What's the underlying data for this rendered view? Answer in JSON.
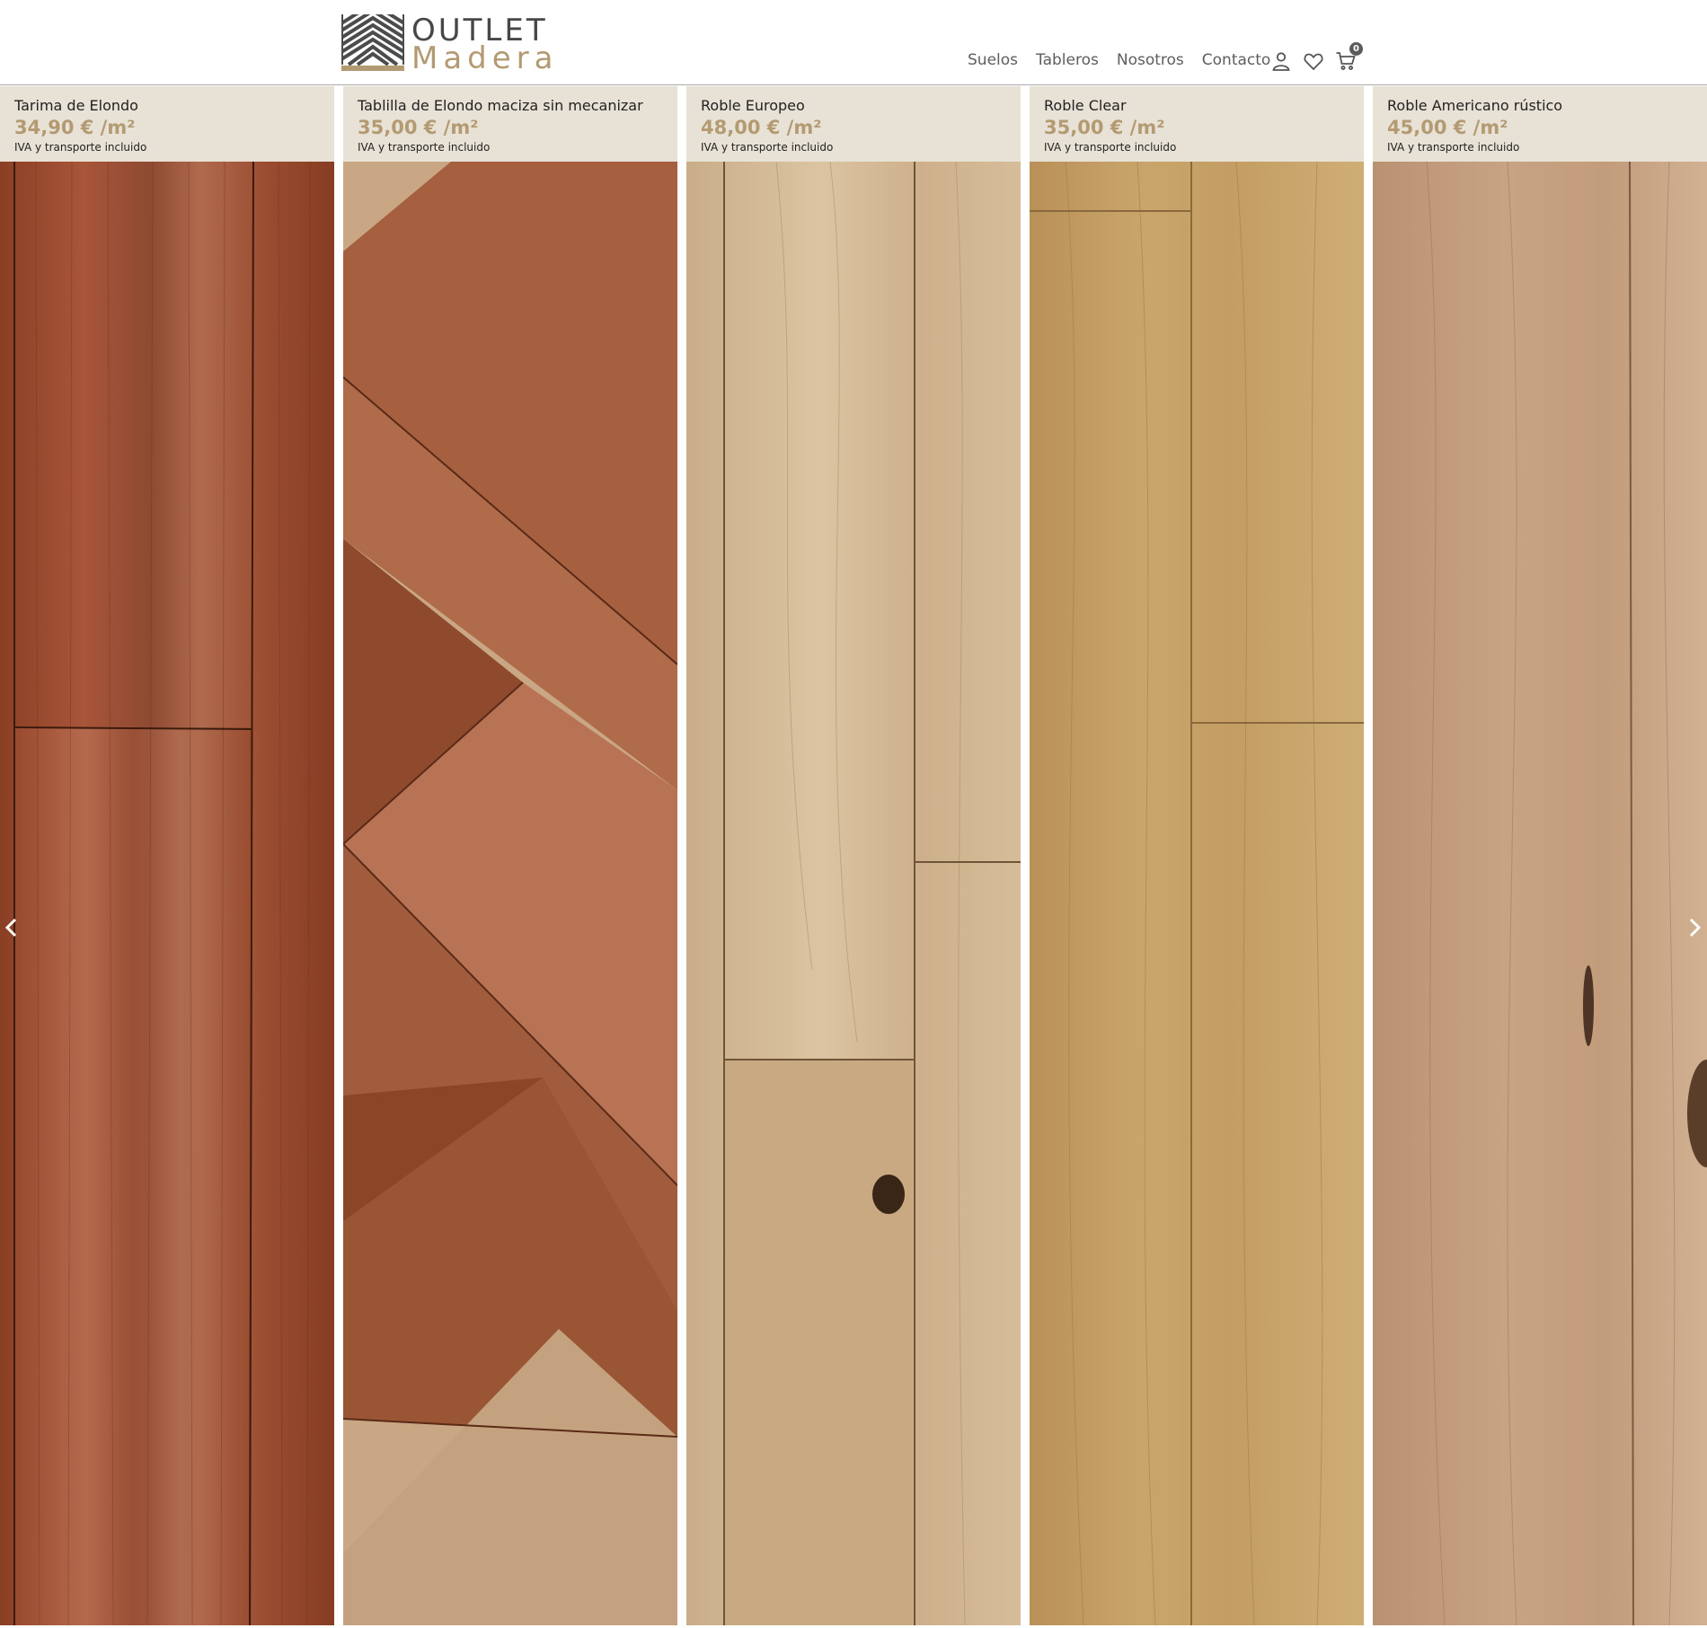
{
  "brand": {
    "line1": "OUTLET",
    "line2": "Madera"
  },
  "nav": {
    "items": [
      {
        "label": "Suelos"
      },
      {
        "label": "Tableros"
      },
      {
        "label": "Nosotros"
      },
      {
        "label": "Contacto"
      }
    ]
  },
  "header_icons": {
    "account": "user-icon",
    "wishlist": "heart-icon",
    "cart": "cart-icon",
    "cart_count": "0"
  },
  "products": [
    {
      "title": "Tarima de Elondo",
      "price": "34,90 € /m²",
      "note": "IVA y transporte incluido"
    },
    {
      "title": "Tablilla de Elondo maciza sin mecanizar",
      "price": "35,00 € /m²",
      "note": "IVA y transporte incluido"
    },
    {
      "title": "Roble Europeo",
      "price": "48,00 € /m²",
      "note": "IVA y transporte incluido"
    },
    {
      "title": "Roble Clear",
      "price": "35,00 € /m²",
      "note": "IVA y transporte incluido"
    },
    {
      "title": "Roble Americano rústico",
      "price": "45,00 € /m²",
      "note": "IVA y transporte incluido"
    }
  ],
  "colors": {
    "accent": "#b39a72",
    "info_band": "#e8e2d6",
    "nav_text": "#5e5e5e"
  }
}
